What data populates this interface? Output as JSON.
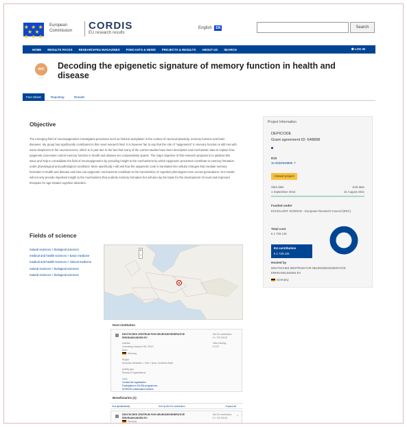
{
  "header": {
    "eu_line1": "European",
    "eu_line2": "Commission",
    "brand": "CORDIS",
    "brand_sub": "EU research results",
    "language": "English",
    "language_code": "EN",
    "search_button": "Search",
    "search_placeholder": ""
  },
  "nav": {
    "items": [
      "HOME",
      "RESULTS PACKS",
      "RESEARCH*EU MAGAZINES",
      "PODCASTS & NEWS",
      "PROJECTS & RESULTS",
      "ABOUT US",
      "SEARCH"
    ],
    "login": "LOG IN"
  },
  "project": {
    "logo_text": "erc",
    "title": "Decoding the epigenetic signature of memory function in health and disease"
  },
  "tabs": [
    "Fact Sheet",
    "Reporting",
    "Results"
  ],
  "objective": {
    "heading": "Objective",
    "text": "The emerging field of neuroepigenetics investigates processes such as histone-acetylation in the context of neuronal plasticity, memory function and brain diseases. My group has significantly contributed to this novel research field. It is however fair to say that the role of \"epigenetics\" in memory function is still met with some skepticism in the neurosciences, which is in part due to the fact that many of the current studies have been descriptive and mechanistic data to explain how epigenetic processes control memory function in health and disease are comparatively sparse. The major objective of this research proposal is to address this issue and help to consolidate the field of neuroepigenetics by providing insight to the mechanisms by which epigenetic processes contribute to memory formation under physiological and pathological conditions. More specifically I will ask how the epigenetic code is translated into cellular changes that mediate memory formation in health and disease and how can epigenetic mechanisms contribute to the transmission of cognitive phenotypes even across generations. Our results will not only provide important insight to the mechanisms that underlie memory formation but will also lay the basis for the development of novel and improved therapies for age-related cognitive disorders."
  },
  "fields": {
    "heading": "Fields of science",
    "items": [
      "natural sciences > biological sciences",
      "medical and health sciences > basic medicine",
      "medical and health sciences > clinical medicine",
      "natural sciences > biological sciences",
      "natural sciences > biological sciences"
    ]
  },
  "map": {
    "zoom_in": "+",
    "zoom_out": "−",
    "colors": {
      "water": "#cfe0ec",
      "land": "#f1efe9",
      "marker": "#c0392b"
    }
  },
  "host": {
    "heading": "Host institution",
    "name": "DEUTSCHES ZENTRUM FUR NEURODEGENERATIVE ERKRANKUNGEN EV",
    "net_label": "Net EU contribution",
    "net_value": "€ 1 729 125,00",
    "address_label": "Address",
    "address": "Venusberg-Campus 1/99, 53127 Bonn",
    "country": "Germany",
    "region_label": "Region",
    "region": "Nordrhein-Westfalen > Köln > Bonn, Kreisfreie Stadt",
    "activity_label": "Activity type",
    "activity": "Research Organisations",
    "links_label": "Links",
    "link1": "Contact the organisation",
    "link2": "Participation in EU R&I programmes",
    "link3": "HORIZON collaboration network",
    "pic_label": "Other funding",
    "pic_value": "€ 0,00"
  },
  "beneficiaries": {
    "heading": "Beneficiaries (1)",
    "sort_label": "Sort alphabetically",
    "sort2_label": "Sort by Net EU contribution",
    "expand_label": "Expand all",
    "name": "DEUTSCHES ZENTRUM FUR NEURODEGENERATIVE ERKRANKUNGEN EV",
    "country": "Germany",
    "net_label": "Net EU contribution",
    "net_value": "€ 1 729 125,00"
  },
  "panel": {
    "heading": "Project Information",
    "acronym": "DEPICODE",
    "grant": "Grant agreement ID: 648898",
    "doi_label": "DOI",
    "doi": "10.3030/648898",
    "status": "Closed project",
    "start_label": "Start date",
    "start": "1 September 2015",
    "end_label": "End date",
    "end": "31 August 2021",
    "funded_label": "Funded under",
    "funded": "EXCELLENT SCIENCE - European Research Council (ERC)",
    "total_label": "Total cost",
    "total": "€ 1 729 125",
    "contrib_label": "EU contribution",
    "contrib": "€ 1 729 125",
    "hosted_label": "Hosted by",
    "hosted": "DEUTSCHES ZENTRUM FUR NEURODEGENERATIVE ERKRANKUNGEN EV",
    "hosted_country": "Germany",
    "contribution_fraction": 1.0,
    "colors": {
      "brand": "#004494",
      "badge": "#f9c23c",
      "timeline": "#a8d6c8"
    }
  }
}
